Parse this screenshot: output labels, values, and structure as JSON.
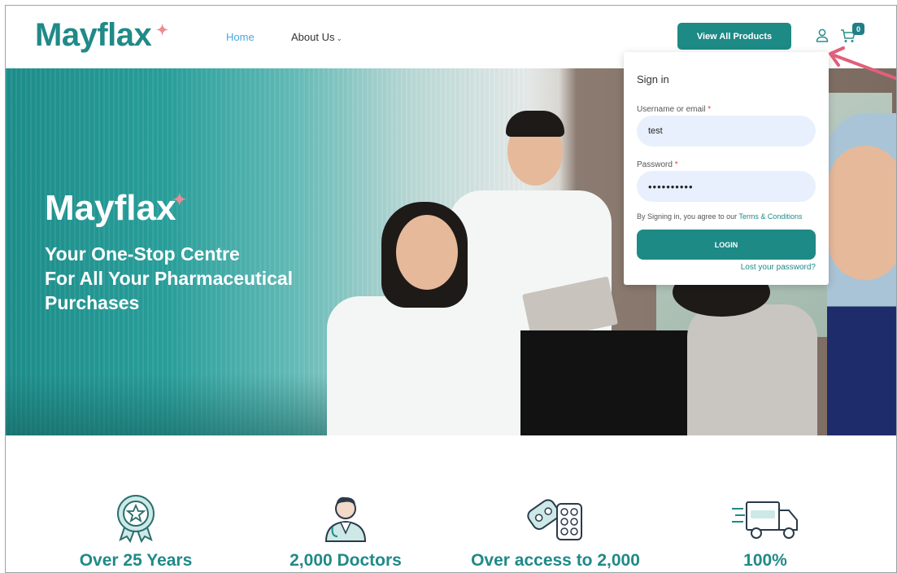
{
  "header": {
    "logo_text": "Mayflax",
    "nav": {
      "home": "Home",
      "about": "About Us"
    },
    "cta_label": "View All Products",
    "cart_count": "0"
  },
  "hero": {
    "logo_text": "Mayflax",
    "tagline_lines": [
      "Your One-Stop Centre",
      "For All Your Pharmaceutical",
      "Purchases"
    ]
  },
  "signin": {
    "title": "Sign in",
    "username_label": "Username or email",
    "username_value": "test",
    "password_label": "Password",
    "password_value": "••••••••••",
    "required_mark": "*",
    "terms_prefix": "By Signing in, you agree to our",
    "terms_link": "Terms & Conditions",
    "login_label": "LOGIN",
    "lost_password": "Lost your password?"
  },
  "features": [
    {
      "icon": "award-badge-icon",
      "text": "Over 25 Years"
    },
    {
      "icon": "doctor-icon",
      "text": "2,000 Doctors"
    },
    {
      "icon": "pills-icon",
      "text": "Over access to  2,000"
    },
    {
      "icon": "delivery-truck-icon",
      "text": "100%"
    }
  ],
  "colors": {
    "brand": "#1f8a88",
    "button": "#1d8a86",
    "accent": "#ef8a92",
    "nav_active": "#4aa7e0",
    "annotation_arrow": "#e0607a"
  }
}
